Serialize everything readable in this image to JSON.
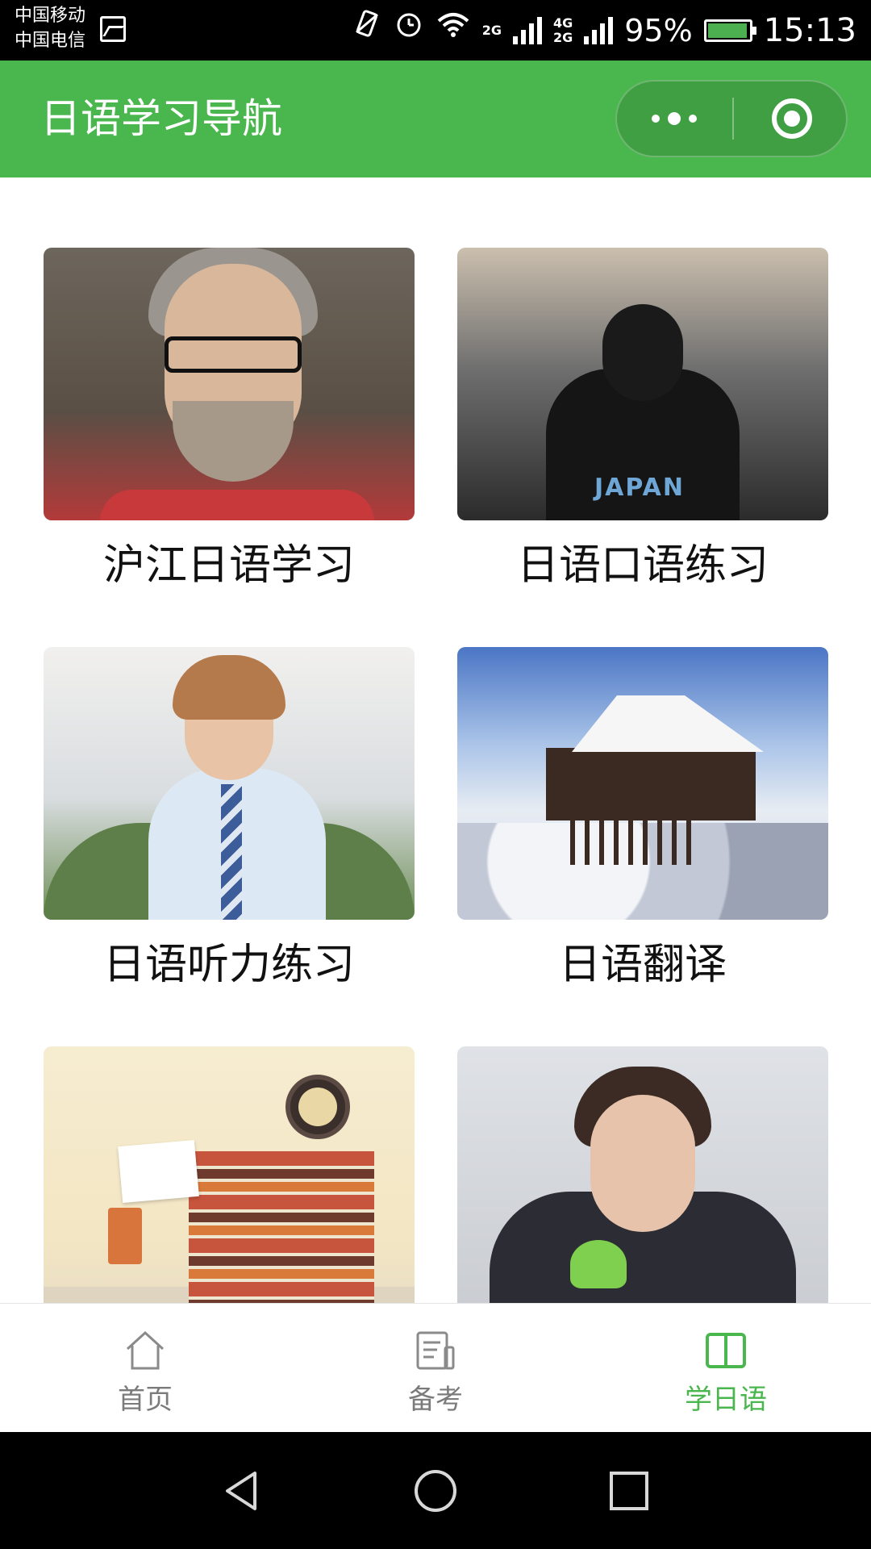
{
  "status_bar": {
    "carrier_1": "中国移动",
    "carrier_2": "中国电信",
    "network_1": "2G",
    "network_2": "4G",
    "network_3": "2G",
    "battery_percent": "95%",
    "battery_level": 0.95,
    "time": "15:13"
  },
  "header": {
    "title": "日语学习导航",
    "background_color": "#4ab64e"
  },
  "cards": [
    {
      "label": "沪江日语学习",
      "image": "grey-haired-man-glasses-photo"
    },
    {
      "label": "日语口语练习",
      "image": "press-crowd-japan-jacket-photo"
    },
    {
      "label": "日语听力练习",
      "image": "student-headphones-tie-photo"
    },
    {
      "label": "日语翻译",
      "image": "snowy-temple-photo"
    },
    {
      "label": "",
      "image": "books-clock-back-to-school-photo"
    },
    {
      "label": "",
      "image": "young-man-clover-photo"
    }
  ],
  "tabbar": {
    "items": [
      {
        "label": "首页",
        "icon": "home-icon",
        "active": false
      },
      {
        "label": "备考",
        "icon": "exam-notes-icon",
        "active": false
      },
      {
        "label": "学日语",
        "icon": "open-book-icon",
        "active": true
      }
    ],
    "active_color": "#4ab64e",
    "inactive_color": "#7b7b7b"
  },
  "system_nav": {
    "back_icon": "back-triangle-icon",
    "home_icon": "home-circle-icon",
    "recents_icon": "recents-square-icon"
  }
}
